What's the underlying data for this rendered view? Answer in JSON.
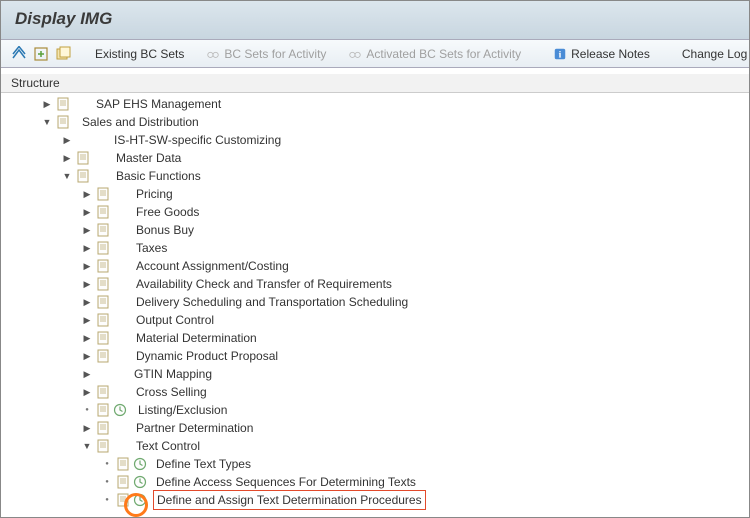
{
  "title": "Display IMG",
  "toolbar": {
    "existing_bc_sets": "Existing BC Sets",
    "bc_sets_for_activity": "BC Sets for Activity",
    "activated_bc_sets_for_activity": "Activated BC Sets for Activity",
    "release_notes": "Release Notes",
    "change_log": "Change Log"
  },
  "structure_header": "Structure",
  "tree": {
    "n0": {
      "label": "SAP EHS Management"
    },
    "n1": {
      "label": "Sales and Distribution"
    },
    "n1_0": {
      "label": "IS-HT-SW-specific Customizing"
    },
    "n1_1": {
      "label": "Master Data"
    },
    "n1_2": {
      "label": "Basic Functions"
    },
    "n1_2_0": {
      "label": "Pricing"
    },
    "n1_2_1": {
      "label": "Free Goods"
    },
    "n1_2_2": {
      "label": "Bonus Buy"
    },
    "n1_2_3": {
      "label": "Taxes"
    },
    "n1_2_4": {
      "label": "Account Assignment/Costing"
    },
    "n1_2_5": {
      "label": "Availability Check and Transfer of Requirements"
    },
    "n1_2_6": {
      "label": "Delivery Scheduling and Transportation Scheduling"
    },
    "n1_2_7": {
      "label": "Output Control"
    },
    "n1_2_8": {
      "label": "Material Determination"
    },
    "n1_2_9": {
      "label": "Dynamic Product Proposal"
    },
    "n1_2_10": {
      "label": "GTIN Mapping"
    },
    "n1_2_11": {
      "label": "Cross Selling"
    },
    "n1_2_12": {
      "label": "Listing/Exclusion"
    },
    "n1_2_13": {
      "label": "Partner Determination"
    },
    "n1_2_14": {
      "label": "Text Control"
    },
    "n1_2_14_0": {
      "label": "Define Text Types"
    },
    "n1_2_14_1": {
      "label": "Define Access Sequences For Determining Texts"
    },
    "n1_2_14_2": {
      "label": "Define and Assign Text Determination Procedures"
    }
  }
}
